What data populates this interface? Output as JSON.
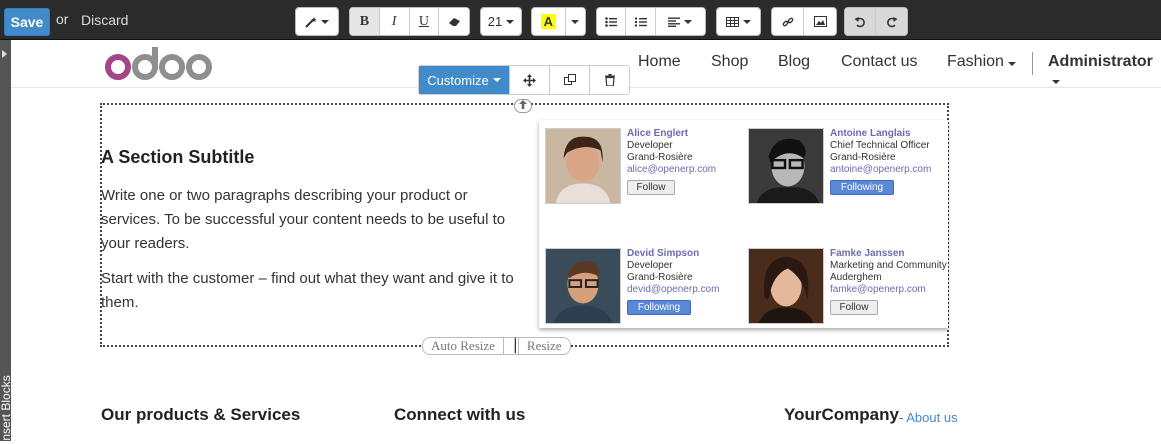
{
  "editbar": {
    "save_label": "Save",
    "or_label": "or",
    "discard_label": "Discard",
    "font_size": "21",
    "highlight_letter": "A"
  },
  "insert_blocks": {
    "label": "Insert Blocks"
  },
  "header": {
    "nav": [
      "Home",
      "Shop",
      "Blog",
      "Contact us",
      "Fashion",
      "Administrator"
    ]
  },
  "customize": {
    "label": "Customize"
  },
  "section": {
    "subtitle": "A Section Subtitle",
    "paragraphs": [
      "Write one or two paragraphs describing your product or services. To be successful your content needs to be useful to your readers.",
      "Start with the customer – find out what they want and give it to them."
    ]
  },
  "cards": [
    {
      "name": "Alice Englert",
      "title": "Developer",
      "place": "Grand-Rosière",
      "email": "alice@openerp.com",
      "button": "Follow",
      "state": "follow"
    },
    {
      "name": "Antoine Langlais",
      "title": "Chief Technical Officer",
      "place": "Grand-Rosière",
      "email": "antoine@openerp.com",
      "button": "Following",
      "state": "following"
    },
    {
      "name": "Devid Simpson",
      "title": "Developer",
      "place": "Grand-Rosière",
      "email": "devid@openerp.com",
      "button": "Following",
      "state": "following"
    },
    {
      "name": "Famke Janssen",
      "title": "Marketing and Community",
      "place": "Auderghem",
      "email": "famke@openerp.com",
      "button": "Follow",
      "state": "follow"
    }
  ],
  "resize": {
    "auto_label": "Auto Resize",
    "resize_label": "Resize"
  },
  "footer": {
    "col1": "Our products & Services",
    "col2": "Connect with us",
    "company": "YourCompany",
    "about_sep": "-",
    "about": "About us"
  },
  "colors": {
    "accent": "#428bca",
    "toolbar_bg": "#2b2b2b",
    "odoo_purple": "#a24689",
    "odoo_grey": "#8f8f8f"
  }
}
